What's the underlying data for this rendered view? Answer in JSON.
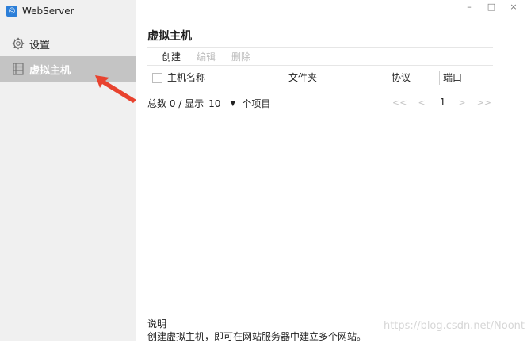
{
  "app": {
    "title": "WebServer",
    "icon": "globe-icon"
  },
  "window_controls": {
    "minimize": "–",
    "maximize": "□",
    "close": "×"
  },
  "sidebar": {
    "items": [
      {
        "label": "设置",
        "icon": "gear-icon",
        "selected": false
      },
      {
        "label": "虚拟主机",
        "icon": "list-icon",
        "selected": true
      }
    ]
  },
  "main": {
    "title": "虚拟主机",
    "toolbar": {
      "create": "创建",
      "edit": "编辑",
      "delete": "删除"
    },
    "table": {
      "columns": [
        "主机名称",
        "文件夹",
        "协议",
        "端口"
      ]
    },
    "pager": {
      "total_text": "总数 0 / 显示",
      "page_size": "10",
      "unit": "个项目",
      "first": "<<",
      "prev": "<",
      "current": "1",
      "next": ">",
      "last": ">>"
    }
  },
  "description": {
    "title": "说明",
    "text": "创建虚拟主机，即可在网站服务器中建立多个网站。"
  },
  "watermark": "https://blog.csdn.net/Noont",
  "colors": {
    "selected_bg": "#c4c4c4",
    "sidebar_bg": "#f0f0f0",
    "accent": "#2b7ed8",
    "arrow": "#e8432f"
  }
}
